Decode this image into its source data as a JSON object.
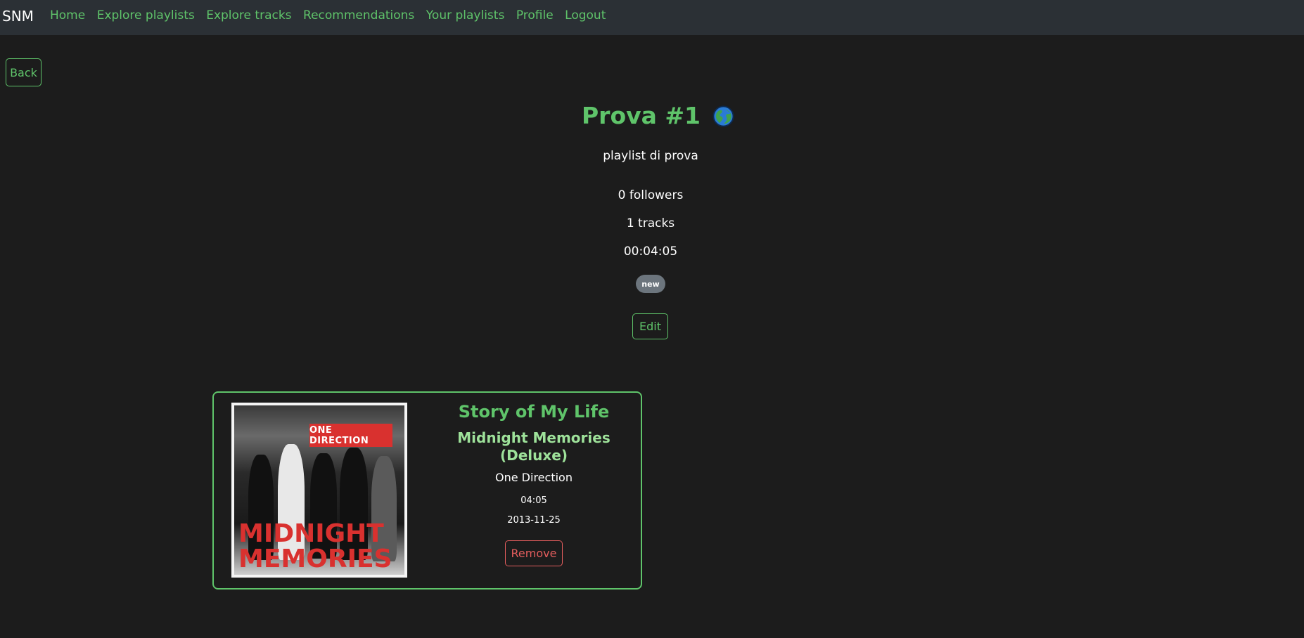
{
  "navbar": {
    "brand": "SNM",
    "links": [
      "Home",
      "Explore playlists",
      "Explore tracks",
      "Recommendations",
      "Your playlists",
      "Profile",
      "Logout"
    ]
  },
  "back_label": "Back",
  "playlist": {
    "title": "Prova #1",
    "visibility_icon": "globe-icon",
    "description": "playlist di prova",
    "followers": "0 followers",
    "tracks": "1 tracks",
    "duration": "00:04:05",
    "tag": "new",
    "edit_label": "Edit"
  },
  "track": {
    "name": "Story of My Life",
    "album": "Midnight Memories (Deluxe)",
    "artist": "One Direction",
    "duration": "04:05",
    "release_date": "2013-11-25",
    "remove_label": "Remove",
    "cover_band_text": "ONE DIRECTION",
    "cover_title_text": "MIDNIGHT MEMORIES"
  },
  "colors": {
    "accent": "#5fc46a",
    "danger": "#e35d5d",
    "background": "#1c1c1c",
    "navbar": "#2b3035"
  }
}
